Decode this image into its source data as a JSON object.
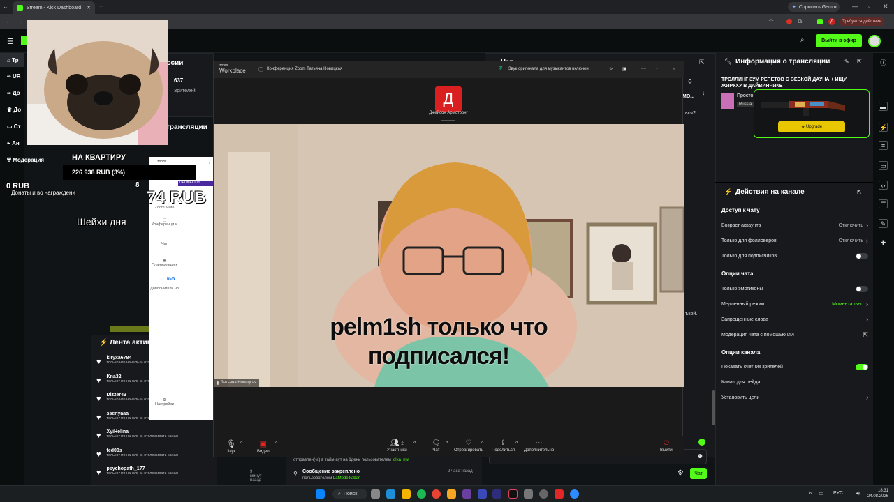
{
  "browser": {
    "tab_title": "Stream - Kick Dashboard",
    "new_tab": "+",
    "gemini_label": "Спросить Gemini",
    "action_required": "Требуется действие",
    "url": ""
  },
  "kick": {
    "go_live": "Выйти в эфир",
    "nav": [
      {
        "label": "Тр",
        "icon": "home-icon"
      },
      {
        "label": "UR",
        "icon": "link-icon"
      },
      {
        "label": "До",
        "icon": "link-icon"
      },
      {
        "label": "До",
        "icon": "trophy-icon"
      },
      {
        "label": "Ст",
        "icon": "stream-icon"
      },
      {
        "label": "Ан",
        "icon": "analytics-icon"
      },
      {
        "label": "Модерация",
        "icon": "shield-icon"
      }
    ],
    "stats_title": "ссии",
    "viewers_count": "637",
    "viewers_label": "Зрителей",
    "stream_section": "трансляции",
    "chat_title": "Чат",
    "chat_partial": [
      "МО...",
      "ься?",
      "ъкой."
    ],
    "activity_title": "Лента актив",
    "activity": [
      {
        "user": "kiryxa6784",
        "text": "только что начал(-а) отс",
        "time": ""
      },
      {
        "user": "Kna32",
        "text": "только что начал(-а) отс",
        "time": ""
      },
      {
        "user": "Dizzer43",
        "text": "только что начал(-а) отс",
        "time": ""
      },
      {
        "user": "ssenyaaa",
        "text": "только что начал(-а) отслеживать канал",
        "time": ""
      },
      {
        "user": "XyiHelina",
        "text": "только что начал(-а) отслеживать канал",
        "time": ""
      },
      {
        "user": "fed00s",
        "text": "только что начал(-а) отслеживать канал",
        "time": ""
      },
      {
        "user": "psychopath_177",
        "text": "только что начал(-а) отслеживать канал",
        "time": "9 минут назад"
      }
    ],
    "mod_log": [
      {
        "title": "",
        "text": "отправлен(-а) в тайм-аут на 1день пользователем",
        "user": "lolka_nw",
        "time": ""
      },
      {
        "title": "Сообщение закреплено",
        "text": "пользователем",
        "user": "LaModelkaban",
        "time": "2 часа назад"
      }
    ],
    "chat_send": "Чат"
  },
  "stream_info": {
    "title": "Информация о трансляции",
    "stream_title": "ТРОЛЛИНГ ЗУМ РЕПЕТОВ С ВЕБКОЙ ДАУНА + ИЩУ ЖИРУХУ В ДАЙВИНЧИКЕ",
    "category": "Просто",
    "tag": "Russia",
    "upgrade": "Upgrade"
  },
  "channel_actions": {
    "title": "Действия на канале",
    "chat_access": "Доступ к чату",
    "rows_access": [
      {
        "label": "Возраст аккаунта",
        "value": "Отключить",
        "type": "chevron"
      },
      {
        "label": "Только для фолловеров",
        "value": "Отключить",
        "type": "chevron"
      },
      {
        "label": "Только для подписчиков",
        "value": "",
        "type": "toggle",
        "on": false
      }
    ],
    "chat_options": "Опции чата",
    "rows_chat": [
      {
        "label": "Только эмотиконы",
        "value": "",
        "type": "toggle",
        "on": false
      },
      {
        "label": "Медленный режим",
        "value": "Моментально",
        "type": "chevron-green"
      },
      {
        "label": "Запрещенные слова",
        "value": "",
        "type": "chevron"
      },
      {
        "label": "Модерация чата с помощью ИИ",
        "value": "",
        "type": "external"
      }
    ],
    "channel_options": "Опции канала",
    "rows_channel": [
      {
        "label": "Показать счетчик зрителей",
        "value": "",
        "type": "toggle",
        "on": true
      },
      {
        "label": "Канал для рейда",
        "value": "",
        "type": "none"
      },
      {
        "label": "Установить цели",
        "value": "",
        "type": "chevron"
      }
    ]
  },
  "zoom": {
    "brand_top": "zoom",
    "brand_bottom": "Workplace",
    "meeting_title": "Конференция Zoom Татьяна Новицкая",
    "audio_notice": "Звук оригинала для музыкантов включен",
    "participant_initial": "Д",
    "participant_name": "Джейсон Армстронг",
    "video_name": "Татьяна Новицкая",
    "toolbar": [
      {
        "label": "Звук",
        "icon": "mic-icon"
      },
      {
        "label": "Видео",
        "icon": "video-off-icon"
      },
      {
        "label": "Участники",
        "icon": "participants-icon",
        "count": "2"
      },
      {
        "label": "Чат",
        "icon": "chat-icon"
      },
      {
        "label": "Отреагировать",
        "icon": "heart-icon"
      },
      {
        "label": "Поделиться",
        "icon": "share-icon"
      },
      {
        "label": "Дополнительно",
        "icon": "more-icon"
      },
      {
        "label": "Выйти",
        "icon": "leave-icon"
      }
    ],
    "side_title": "zoom",
    "side_items": [
      "Zoom Mate",
      "Конференци и",
      "Чат",
      "Планировщи к",
      "Дополнитель но",
      "Настройки"
    ],
    "side_new": "NEW",
    "side_tag": "ПРОФЕССИ"
  },
  "overlay": {
    "goal_title": "НА КВАРТИРУ",
    "goal_value": "226 938 RUB (3%)",
    "zero": "0 RUB",
    "rewards": "Донаты и во награждени",
    "big_amount": "74 RUB",
    "big_prefix": "8",
    "shejhi": "Шейхи дня",
    "alert": "pelm1sh только что подписался!"
  },
  "taskbar": {
    "search": "Поиск",
    "lang": "РУС",
    "time": "18:31",
    "date": "24.08.2026"
  }
}
